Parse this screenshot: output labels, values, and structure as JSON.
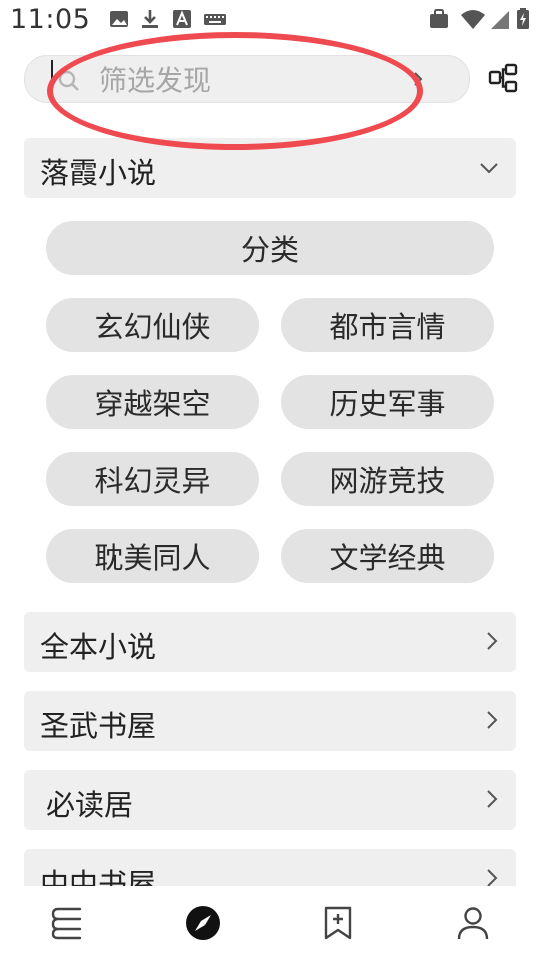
{
  "status_bar": {
    "time": "11:05",
    "left_icons": [
      "image-icon",
      "download-icon",
      "font-icon",
      "keyboard-icon"
    ],
    "right_icons": [
      "briefcase-icon",
      "wifi-icon",
      "signal-icon",
      "battery-icon"
    ]
  },
  "search": {
    "placeholder": "筛选发现"
  },
  "sections": [
    {
      "label": "落霞小说",
      "expanded": true
    },
    {
      "label": "全本小说",
      "expanded": false
    },
    {
      "label": "圣武书屋",
      "expanded": false
    },
    {
      "label": "必读居",
      "expanded": false
    },
    {
      "label": "中中书屋",
      "expanded": false
    }
  ],
  "categories": {
    "header": "分类",
    "items": [
      "玄幻仙侠",
      "都市言情",
      "穿越架空",
      "历史军事",
      "科幻灵异",
      "网游竞技",
      "耽美同人",
      "文学经典"
    ]
  },
  "bottom_nav": {
    "items": [
      "bookshelf-icon",
      "discover-icon",
      "bookmark-add-icon",
      "profile-icon"
    ],
    "active_index": 1
  },
  "colors": {
    "chip_bg": "#e3e3e3",
    "section_bg": "#efefef",
    "annotation": "#ee4a4f"
  }
}
